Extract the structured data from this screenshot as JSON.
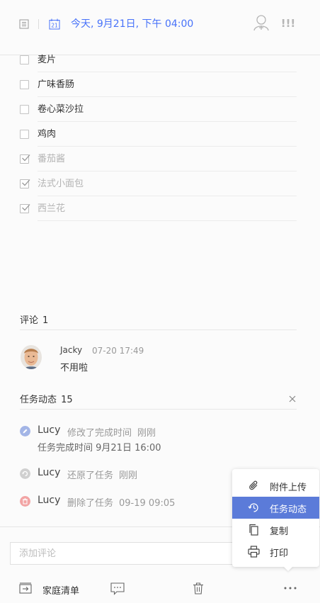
{
  "header": {
    "date_text": "今天, 9月21日, 下午 04:00",
    "calendar_day": "21",
    "priority_mark": "!!!"
  },
  "checklist": [
    {
      "label": "麦片",
      "done": false
    },
    {
      "label": "广味香肠",
      "done": false
    },
    {
      "label": "卷心菜沙拉",
      "done": false
    },
    {
      "label": "鸡肉",
      "done": false
    },
    {
      "label": "番茄酱",
      "done": true
    },
    {
      "label": "法式小面包",
      "done": true
    },
    {
      "label": "西兰花",
      "done": true
    }
  ],
  "comments": {
    "title": "评论",
    "count": "1",
    "items": [
      {
        "author": "Jacky",
        "time": "07-20 17:49",
        "text": "不用啦"
      }
    ]
  },
  "activity": {
    "title": "任务动态",
    "count": "15",
    "items": [
      {
        "user": "Lucy",
        "action": "修改了完成时间",
        "time": "刚刚",
        "detail": "任务完成时间 9月21日 16:00",
        "icon": "edit-icon",
        "color": "#a3b5e6"
      },
      {
        "user": "Lucy",
        "action": "还原了任务",
        "time": "刚刚",
        "detail": "",
        "icon": "restore-icon",
        "color": "#d0d0d0"
      },
      {
        "user": "Lucy",
        "action": "删除了任务",
        "time": "09-19 09:05",
        "detail": "",
        "icon": "trash-icon",
        "color": "#f2a4a4"
      }
    ]
  },
  "comment_input": {
    "placeholder": "添加评论"
  },
  "toolbar": {
    "list_name": "家庭清单"
  },
  "menu": {
    "items": [
      {
        "label": "附件上传",
        "icon": "paperclip-icon",
        "active": false
      },
      {
        "label": "任务动态",
        "icon": "history-icon",
        "active": true
      },
      {
        "label": "复制",
        "icon": "copy-icon",
        "active": false
      },
      {
        "label": "打印",
        "icon": "printer-icon",
        "active": false
      }
    ]
  },
  "colors": {
    "accent": "#4772fa",
    "menu_active": "#5b7bd9"
  }
}
